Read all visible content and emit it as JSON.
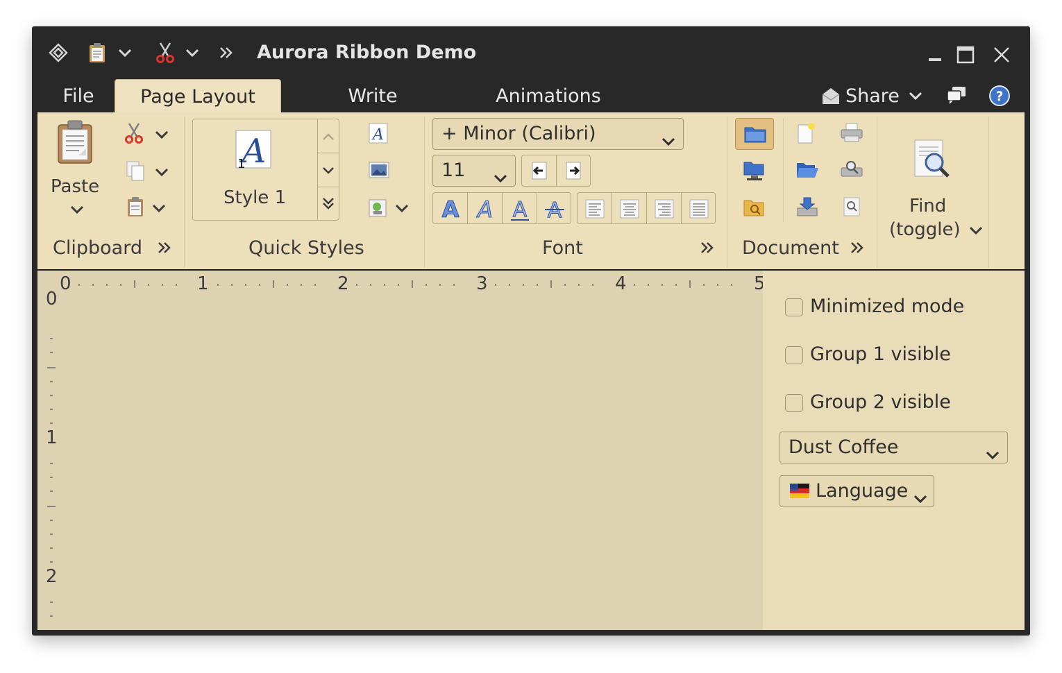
{
  "window": {
    "title": "Aurora Ribbon Demo"
  },
  "titlebar_icons": [
    "app-diamond-icon",
    "clipboard-icon",
    "chevron-down-icon",
    "scissors-icon",
    "chevron-down-icon",
    "double-chevron-right-icon"
  ],
  "tabs": [
    {
      "label": "File",
      "active": false
    },
    {
      "label": "Page Layout",
      "active": true
    },
    {
      "label": "Write",
      "active": false
    },
    {
      "label": "Animations",
      "active": false
    }
  ],
  "share": {
    "label": "Share"
  },
  "groups": {
    "clipboard": {
      "title": "Clipboard",
      "paste_label": "Paste"
    },
    "quick_styles": {
      "title": "Quick Styles",
      "style_label": "Style 1"
    },
    "font": {
      "title": "Font",
      "font_name": "+ Minor (Calibri)",
      "font_size": "11"
    },
    "document": {
      "title": "Document"
    },
    "find": {
      "line1": "Find",
      "line2": "(toggle)"
    }
  },
  "ruler": {
    "horizontal": [
      "0",
      "1",
      "2",
      "3",
      "4",
      "5"
    ],
    "vertical": [
      "0",
      "1",
      "2"
    ]
  },
  "side_panel": {
    "checkboxes": [
      {
        "label": "Minimized mode",
        "checked": false
      },
      {
        "label": "Group 1 visible",
        "checked": false
      },
      {
        "label": "Group 2 visible",
        "checked": false
      }
    ],
    "skin_combo": "Dust Coffee",
    "language_label": "Language"
  },
  "colors": {
    "ribbon_bg": "#ecdfba",
    "titlebar_bg": "#282828",
    "content_bg": "#ddd2b2",
    "accent_red": "#d8352b",
    "accent_blue": "#2b4f9a"
  }
}
